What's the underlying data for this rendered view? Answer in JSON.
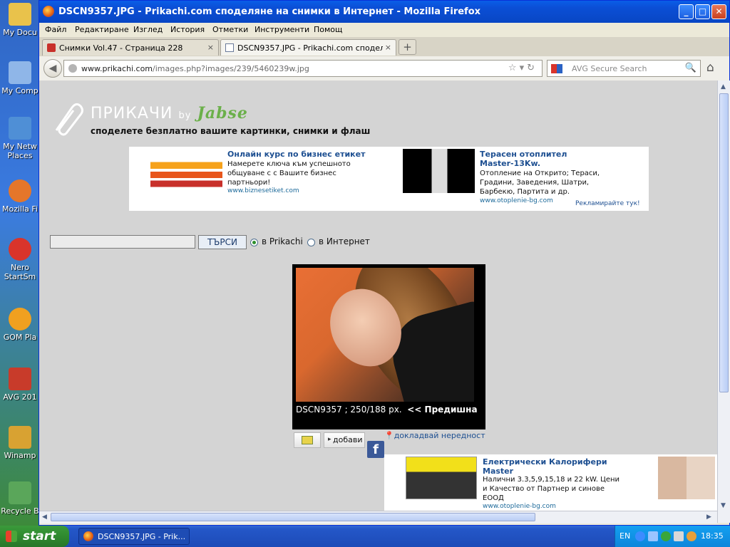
{
  "desktop": {
    "icons": [
      {
        "label": "My Docu",
        "color": "#e9c24b"
      },
      {
        "label": "My Comp",
        "color": "#8fb6e8"
      },
      {
        "label": "My Netw Places",
        "color": "#4f8fd6"
      },
      {
        "label": "Mozilla Fi",
        "color": "#e5762a"
      },
      {
        "label": "Nero StartSm",
        "color": "#d9342b"
      },
      {
        "label": "GOM Pla",
        "color": "#f0a020"
      },
      {
        "label": "AVG 201",
        "color": "#c83b2a"
      },
      {
        "label": "Winamp",
        "color": "#d8a232"
      },
      {
        "label": "Recycle B",
        "color": "#5aa65a"
      }
    ]
  },
  "window": {
    "title": "DSCN9357.JPG - Prikachi.com споделяне на снимки в Интернет - Mozilla Firefox",
    "buttons": {
      "minimize": "_",
      "maximize": "□",
      "close": "✕"
    }
  },
  "menu": [
    "Файл",
    "Редактиране",
    "Изглед",
    "История",
    "Отметки",
    "Инструменти",
    "Помощ"
  ],
  "tabs": [
    {
      "label": "Снимки Vol.47 - Страница 228",
      "close": "×",
      "active": false
    },
    {
      "label": "DSCN9357.JPG - Prikachi.com споделян...",
      "close": "×",
      "active": true
    }
  ],
  "newtab": "+",
  "nav": {
    "back": "◀",
    "url_host": "www.prikachi.com",
    "url_path": "/images.php?images/239/5460239w.jpg",
    "url_icons": "☆▾↻",
    "search_placeholder": "AVG Secure Search",
    "search_icon": "🔍",
    "home_icon": "⌂"
  },
  "site": {
    "brand": "ПРИКАЧИ",
    "by": "by",
    "partner": "Jabse",
    "tagline": "споделете безплатно вашите картинки, снимки и флаш"
  },
  "ads": {
    "ad1": {
      "title": "Онлайн курс по бизнес етикет",
      "text": "Намерете ключа към успешното общуване с с Вашите бизнес партньори!",
      "link": "www.biznesetiket.com"
    },
    "ad2": {
      "title": "Терасен отоплител Master-13Kw.",
      "text": "Отопление на Открито; Тераси, Градини, Заведения, Шатри, Барбекю, Партита и др.",
      "link": "www.otoplenie-bg.com"
    },
    "more": "Рекламирайте тук!",
    "ad3": {
      "title": "Електрически Калорифери Master",
      "text": "Налични 3.3,5,9,15,18 и 22 kW. Цени и Качество от Партнер и синове ЕООД",
      "link": "www.otoplenie-bg.com"
    }
  },
  "search": {
    "button": "ТЪРСИ",
    "opt1": "в Prikachi",
    "opt2": "в Интернет"
  },
  "image": {
    "caption": "DSCN9357 ; 250/188 px.",
    "prev": "<< Предишна"
  },
  "actions": {
    "add": "добави",
    "report": "докладвай нередност",
    "fb": "f"
  },
  "taskbar": {
    "start": "start",
    "item": "DSCN9357.JPG - Prik...",
    "lang": "EN",
    "clock": "18:35"
  }
}
